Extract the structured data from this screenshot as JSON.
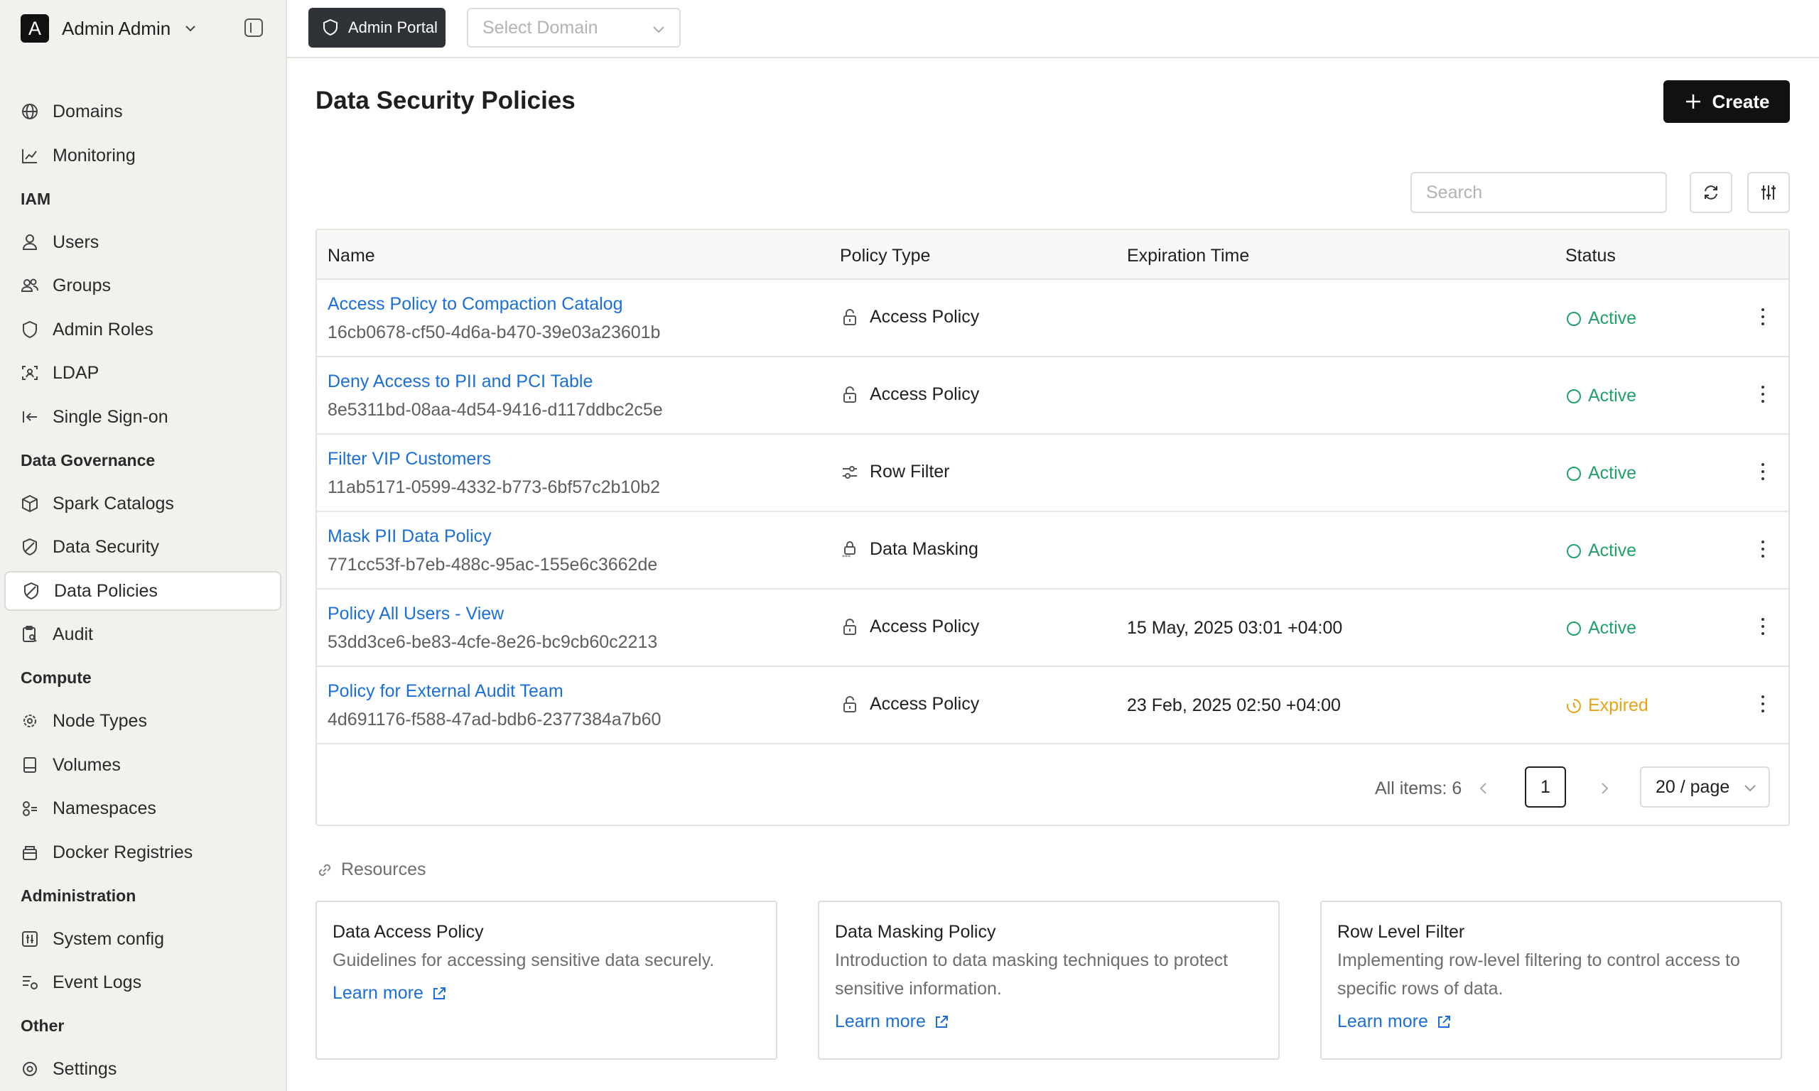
{
  "user": {
    "avatar_letter": "A",
    "name": "Admin Admin"
  },
  "sidebar": {
    "items": [
      {
        "label": "Domains",
        "icon": "globe-icon"
      },
      {
        "label": "Monitoring",
        "icon": "chart-line-icon"
      },
      {
        "label": "Users",
        "icon": "user-icon"
      },
      {
        "label": "Groups",
        "icon": "users-icon"
      },
      {
        "label": "Admin Roles",
        "icon": "shield-icon"
      },
      {
        "label": "LDAP",
        "icon": "scan-face-icon"
      },
      {
        "label": "Single Sign-on",
        "icon": "login-arrow-icon"
      },
      {
        "label": "Spark Catalogs",
        "icon": "cube-icon"
      },
      {
        "label": "Data Security",
        "icon": "shield-slash-icon"
      },
      {
        "label": "Data Policies",
        "icon": "shield-slash-icon"
      },
      {
        "label": "Audit",
        "icon": "clipboard-search-icon"
      },
      {
        "label": "Node Types",
        "icon": "cog-nodes-icon"
      },
      {
        "label": "Volumes",
        "icon": "cylinder-icon"
      },
      {
        "label": "Namespaces",
        "icon": "boxes-icon"
      },
      {
        "label": "Docker Registries",
        "icon": "container-icon"
      },
      {
        "label": "System config",
        "icon": "sliders-square-icon"
      },
      {
        "label": "Event Logs",
        "icon": "list-bullet-icon"
      },
      {
        "label": "Settings",
        "icon": "gear-icon"
      }
    ],
    "sections": [
      "IAM",
      "Data Governance",
      "Compute",
      "Administration",
      "Other"
    ]
  },
  "topbar": {
    "portal_label": "Admin Portal",
    "domain_placeholder": "Select Domain"
  },
  "page": {
    "title": "Data Security Policies",
    "create_label": "Create",
    "search_placeholder": "Search"
  },
  "table": {
    "columns": [
      "Name",
      "Policy Type",
      "Expiration Time",
      "Status"
    ],
    "rows": [
      {
        "name": "Access Policy to Compaction Catalog",
        "id": "16cb0678-cf50-4d6a-b470-39e03a23601b",
        "type": "Access Policy",
        "type_icon": "lock-open-icon",
        "expiration": "",
        "status": "Active"
      },
      {
        "name": "Deny Access to PII and PCI Table",
        "id": "8e5311bd-08aa-4d54-9416-d117ddbc2c5e",
        "type": "Access Policy",
        "type_icon": "lock-open-icon",
        "expiration": "",
        "status": "Active"
      },
      {
        "name": "Filter VIP Customers",
        "id": "11ab5171-0599-4332-b773-6bf57c2b10b2",
        "type": "Row Filter",
        "type_icon": "filter-sliders-icon",
        "expiration": "",
        "status": "Active"
      },
      {
        "name": "Mask PII Data Policy",
        "id": "771cc53f-b7eb-488c-95ac-155e6c3662de",
        "type": "Data Masking",
        "type_icon": "lock-asterisk-icon",
        "expiration": "",
        "status": "Active"
      },
      {
        "name": "Policy All Users - View",
        "id": "53dd3ce6-be83-4cfe-8e26-bc9cb60c2213",
        "type": "Access Policy",
        "type_icon": "lock-open-icon",
        "expiration": "15 May, 2025 03:01 +04:00",
        "status": "Active"
      },
      {
        "name": "Policy for External Audit Team",
        "id": "4d691176-f588-47ad-bdb6-2377384a7b60",
        "type": "Access Policy",
        "type_icon": "lock-open-icon",
        "expiration": "23 Feb, 2025 02:50 +04:00",
        "status": "Expired"
      }
    ]
  },
  "pagination": {
    "all_items": "All items: 6",
    "current_page": "1",
    "page_size": "20 / page"
  },
  "resources": {
    "heading": "Resources",
    "cards": [
      {
        "title": "Data Access Policy",
        "description": "Guidelines for accessing sensitive data securely.",
        "link": "Learn more"
      },
      {
        "title": "Data Masking Policy",
        "description": "Introduction to data masking techniques to protect sensitive information.",
        "link": "Learn more"
      },
      {
        "title": "Row Level Filter",
        "description": "Implementing row-level filtering to control access to specific rows of data.",
        "link": "Learn more"
      }
    ]
  },
  "colors": {
    "active": "#22a06b",
    "expired": "#e8a317",
    "link": "#1a6fd8",
    "accent_dark": "#111111"
  }
}
